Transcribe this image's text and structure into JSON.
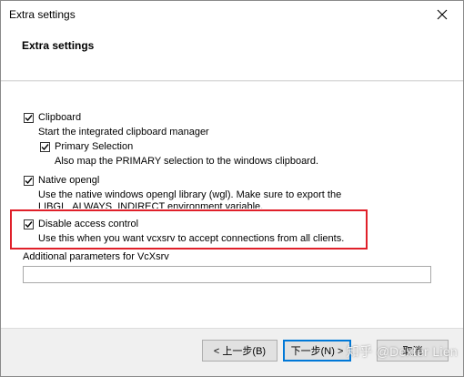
{
  "window": {
    "title": "Extra settings"
  },
  "header": {
    "title": "Extra settings"
  },
  "options": {
    "clipboard": {
      "label": "Clipboard",
      "checked": true,
      "description": "Start the integrated clipboard manager"
    },
    "primary_selection": {
      "label": "Primary Selection",
      "checked": true,
      "description": "Also map the PRIMARY selection to the windows clipboard."
    },
    "native_opengl": {
      "label": "Native opengl",
      "checked": true,
      "description_line1": "Use the native windows opengl library (wgl). Make sure to export the",
      "description_line2": "LIBGL_ALWAYS_INDIRECT environment variable."
    },
    "disable_access_control": {
      "label": "Disable access control",
      "checked": true,
      "description": "Use this when you want vcxsrv to accept connections from all clients."
    }
  },
  "params": {
    "label": "Additional parameters for VcXsrv",
    "value": ""
  },
  "buttons": {
    "back": "< 上一步(B)",
    "next": "下一步(N) >",
    "cancel": "取消"
  },
  "watermark": "知乎 @Dexter Lien",
  "colors": {
    "highlight_border": "#e0202a",
    "default_button_border": "#0078d7"
  },
  "icons": {
    "close": "close-icon",
    "check": "check-icon"
  }
}
